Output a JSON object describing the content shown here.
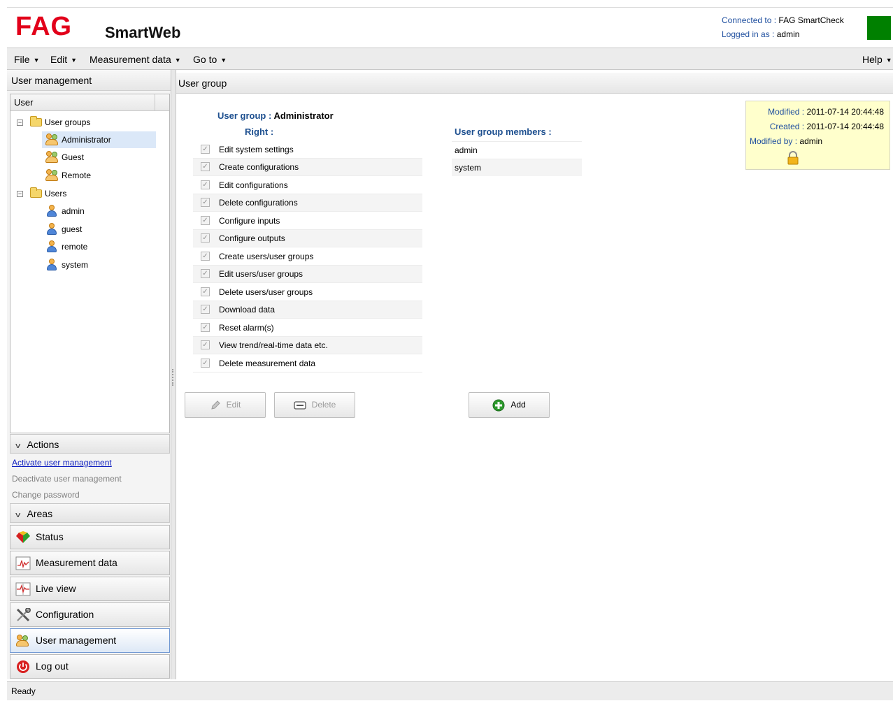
{
  "header": {
    "logo_brand": "FAG",
    "logo_product": "SmartWeb",
    "connected_label": "Connected to :",
    "connected_value": "FAG SmartCheck",
    "logged_label": "Logged in as :",
    "logged_value": "admin",
    "status_color": "#008000"
  },
  "menu": {
    "file": "File",
    "edit": "Edit",
    "measurement": "Measurement data",
    "goto": "Go to",
    "help": "Help"
  },
  "left": {
    "title": "User management",
    "tree_header": "User",
    "tree": {
      "groups_label": "User groups",
      "groups": [
        "Administrator",
        "Guest",
        "Remote"
      ],
      "users_label": "Users",
      "users": [
        "admin",
        "guest",
        "remote",
        "system"
      ],
      "selected": "Administrator"
    },
    "actions": {
      "title": "Actions",
      "items": [
        "Activate user management",
        "Deactivate user management",
        "Change password"
      ]
    },
    "areas": {
      "title": "Areas",
      "items": [
        "Status",
        "Measurement data",
        "Live view",
        "Configuration",
        "User management",
        "Log out"
      ],
      "selected": "User management"
    }
  },
  "main": {
    "title": "User group",
    "group_label": "User group :",
    "group_name": "Administrator",
    "rights_header": "Right :",
    "rights": [
      "Edit system settings",
      "Create configurations",
      "Edit configurations",
      "Delete configurations",
      "Configure inputs",
      "Configure outputs",
      "Create users/user groups",
      "Edit users/user groups",
      "Delete users/user groups",
      "Download data",
      "Reset alarm(s)",
      "View trend/real-time data etc.",
      "Delete measurement data"
    ],
    "members_header": "User group members :",
    "members": [
      "admin",
      "system"
    ],
    "buttons": {
      "edit": "Edit",
      "delete": "Delete",
      "add": "Add"
    },
    "meta": {
      "modified_label": "Modified :",
      "modified_value": "2011-07-14 20:44:48",
      "created_label": "Created :",
      "created_value": "2011-07-14 20:44:48",
      "modified_by_label": "Modified by :",
      "modified_by_value": "admin"
    }
  },
  "status_bar": "Ready"
}
